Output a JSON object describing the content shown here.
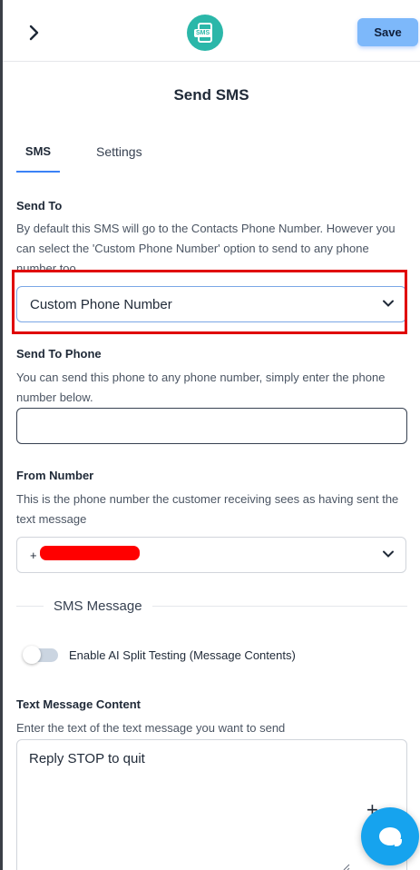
{
  "header": {
    "save_label": "Save",
    "logo_text": "SMS"
  },
  "page_title": "Send SMS",
  "tabs": [
    {
      "label": "SMS",
      "active": true
    },
    {
      "label": "Settings",
      "active": false
    }
  ],
  "send_to": {
    "label": "Send To",
    "help": "By default this SMS will go to the Contacts Phone Number. However you can select the 'Custom Phone Number' option to send to any phone number too.",
    "selected": "Custom Phone Number"
  },
  "send_to_phone": {
    "label": "Send To Phone",
    "help": "You can send this phone to any phone number, simply enter the phone number below.",
    "value": ""
  },
  "from_number": {
    "label": "From Number",
    "help": "This is the phone number the customer receiving sees as having sent the text message",
    "prefix": "+"
  },
  "sms_message": {
    "section_label": "SMS Message",
    "ai_toggle_label": "Enable AI Split Testing (Message Contents)",
    "ai_toggle_on": false
  },
  "text_message": {
    "label": "Text Message Content",
    "help": "Enter the text of the text message you want to send",
    "content": "Reply STOP to quit"
  },
  "colors": {
    "accent": "#3b82f6",
    "save_button": "#7db8fa",
    "logo": "#2bb7a9",
    "highlight": "#e00000",
    "chat_fab": "#16a3ee"
  }
}
